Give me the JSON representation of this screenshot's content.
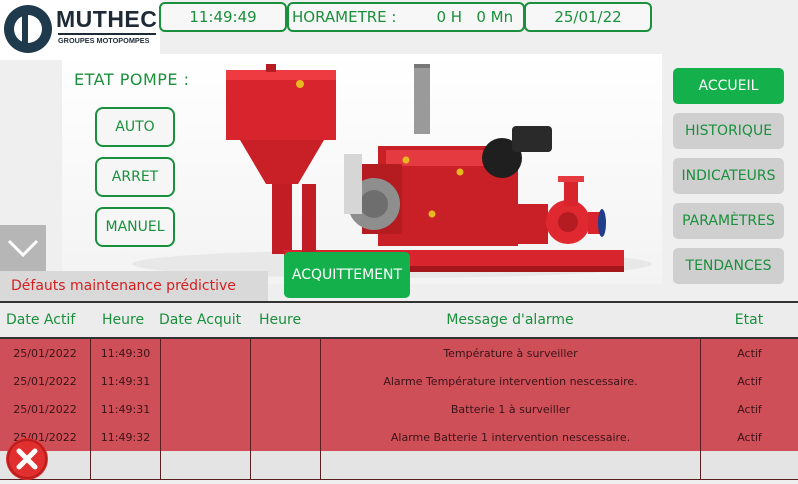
{
  "logo": {
    "name": "MUTHEC",
    "subtitle": "GROUPES MOTOPOMPES"
  },
  "header": {
    "time": "11:49:49",
    "horametre_label": "HORAMETRE :",
    "horametre_value": "0 H   0 Mn",
    "date": "25/01/22"
  },
  "etat_pompe": {
    "title": "ETAT POMPE :",
    "modes": [
      "AUTO",
      "ARRET",
      "MANUEL"
    ]
  },
  "nav": {
    "items": [
      "ACCUEIL",
      "HISTORIQUE",
      "INDICATEURS",
      "PARAMÈTRES",
      "TENDANCES"
    ],
    "active": "ACCUEIL"
  },
  "actions": {
    "acquittement": "ACQUITTEMENT"
  },
  "alarms": {
    "section_title": "Défauts maintenance prédictive",
    "columns": [
      "Date Actif",
      "Heure",
      "Date Acquit",
      "Heure",
      "Message d'alarme",
      "Etat"
    ],
    "rows": [
      [
        "25/01/2022",
        "11:49:30",
        "",
        "",
        "Température à surveiller",
        "Actif"
      ],
      [
        "25/01/2022",
        "11:49:31",
        "",
        "",
        "Alarme Température intervention nescessaire.",
        "Actif"
      ],
      [
        "25/01/2022",
        "11:49:31",
        "",
        "",
        "Batterie 1 à surveiller",
        "Actif"
      ],
      [
        "25/01/2022",
        "11:49:32",
        "",
        "",
        "Alarme Batterie 1 intervention nescessaire.",
        "Actif"
      ]
    ]
  },
  "icons": {
    "collapse": "chevron-down-icon",
    "close": "close-icon"
  },
  "colors": {
    "accent_green": "#13b04b",
    "text_green": "#1a8f3c",
    "alarm_row": "#cf4f59",
    "alarm_text": "#d42020",
    "pump_red": "#d8242c"
  }
}
